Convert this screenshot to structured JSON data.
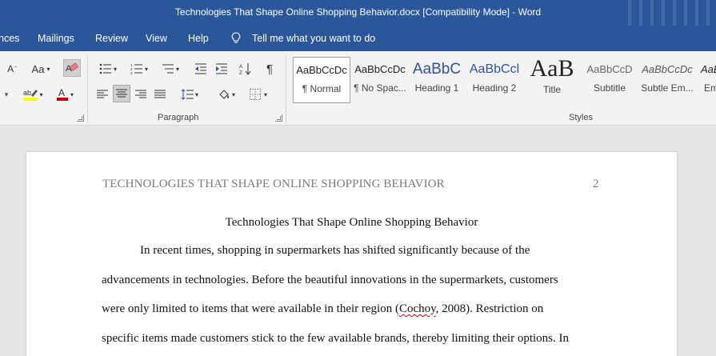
{
  "window": {
    "title": "Technologies That Shape Online Shopping Behavior.docx [Compatibility Mode]  -  Word"
  },
  "menu": {
    "tabs": [
      "nces",
      "Mailings",
      "Review",
      "View",
      "Help"
    ],
    "tell_me": "Tell me what you want to do"
  },
  "ribbon": {
    "font_group": {
      "change_case": "Aa"
    },
    "paragraph_group": {
      "label": "Paragraph"
    },
    "styles_group": {
      "label": "Styles",
      "items": [
        {
          "preview": "AaBbCcDc",
          "label": "¶ Normal"
        },
        {
          "preview": "AaBbCcDc",
          "label": "¶ No Spac..."
        },
        {
          "preview": "AaBbC",
          "label": "Heading 1"
        },
        {
          "preview": "AaBbCcl",
          "label": "Heading 2"
        },
        {
          "preview": "AaB",
          "label": "Title"
        },
        {
          "preview": "AaBbCcD",
          "label": "Subtitle"
        },
        {
          "preview": "AaBbCcDc",
          "label": "Subtle Em..."
        },
        {
          "preview": "AaBbCcDc",
          "label": "Em"
        }
      ]
    }
  },
  "document": {
    "header": "TECHNOLOGIES THAT SHAPE ONLINE SHOPPING BEHAVIOR",
    "page_number": "2",
    "title": "Technologies That Shape Online Shopping Behavior",
    "lines": [
      {
        "before": "In recent times, shopping in supermarkets has shifted significantly because of the",
        "flag": "",
        "after": ""
      },
      {
        "before": "advancements in technologies. Before the beautiful innovations in the supermarkets, customers",
        "flag": "",
        "after": ""
      },
      {
        "before": "were only limited to items that were available in their region (",
        "flag": "Cochoy",
        "after": ", 2008). Restriction on"
      },
      {
        "before": "specific items made customers stick to the few available brands, thereby limiting their options. In",
        "flag": "",
        "after": ""
      }
    ]
  },
  "colors": {
    "title_bar": "#2b579a",
    "ribbon_bg": "#f3f3f3",
    "canvas_bg": "#e6e6e6",
    "heading_blue": "#2f5496",
    "highlight_yellow": "#ffff00",
    "font_color_red": "#c00000"
  }
}
